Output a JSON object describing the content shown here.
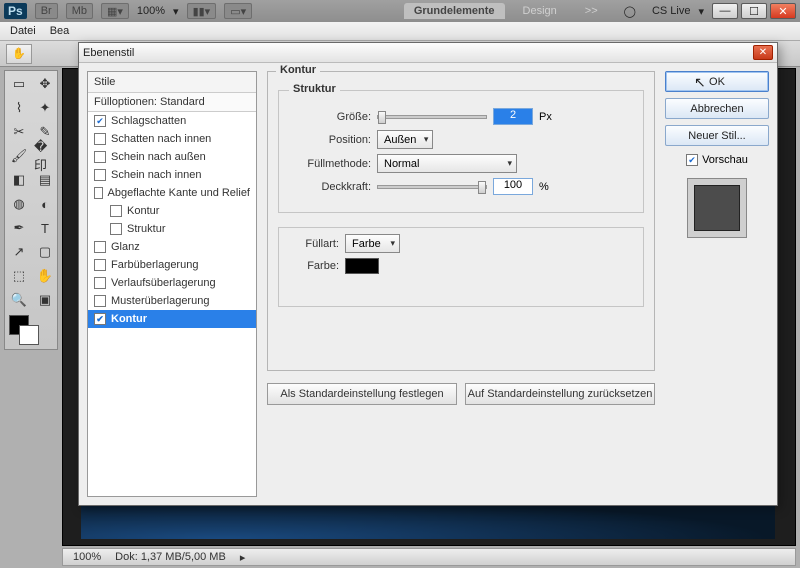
{
  "app": {
    "zoom": "100%",
    "workspace_active": "Grundelemente",
    "workspace_b": "Design",
    "more": ">>",
    "cslive": "CS Live"
  },
  "menu": {
    "file": "Datei",
    "edit_partial": "Bea"
  },
  "dialog": {
    "title": "Ebenenstil",
    "styles_header": "Stile",
    "fill_options": "Fülloptionen: Standard",
    "items": [
      {
        "label": "Schlagschatten",
        "checked": true
      },
      {
        "label": "Schatten nach innen",
        "checked": false
      },
      {
        "label": "Schein nach außen",
        "checked": false
      },
      {
        "label": "Schein nach innen",
        "checked": false
      },
      {
        "label": "Abgeflachte Kante und Relief",
        "checked": false
      },
      {
        "label": "Kontur",
        "checked": false,
        "indent": true
      },
      {
        "label": "Struktur",
        "checked": false,
        "indent": true
      },
      {
        "label": "Glanz",
        "checked": false
      },
      {
        "label": "Farbüberlagerung",
        "checked": false
      },
      {
        "label": "Verlaufsüberlagerung",
        "checked": false
      },
      {
        "label": "Musterüberlagerung",
        "checked": false
      },
      {
        "label": "Kontur",
        "checked": true,
        "selected": true
      }
    ],
    "panel_title": "Kontur",
    "struktur": {
      "legend": "Struktur",
      "size_label": "Größe:",
      "size_value": "2",
      "size_unit": "Px",
      "position_label": "Position:",
      "position_value": "Außen",
      "blend_label": "Füllmethode:",
      "blend_value": "Normal",
      "opacity_label": "Deckkraft:",
      "opacity_value": "100",
      "opacity_unit": "%"
    },
    "fill": {
      "type_label": "Füllart:",
      "type_value": "Farbe",
      "color_label": "Farbe:",
      "color_value": "#000000"
    },
    "buttons": {
      "make_default": "Als Standardeinstellung festlegen",
      "reset_default": "Auf Standardeinstellung zurücksetzen"
    },
    "right": {
      "ok": "OK",
      "cancel": "Abbrechen",
      "new_style": "Neuer Stil...",
      "preview": "Vorschau"
    }
  },
  "status": {
    "zoom": "100%",
    "doc": "Dok: 1,37 MB/5,00 MB"
  }
}
